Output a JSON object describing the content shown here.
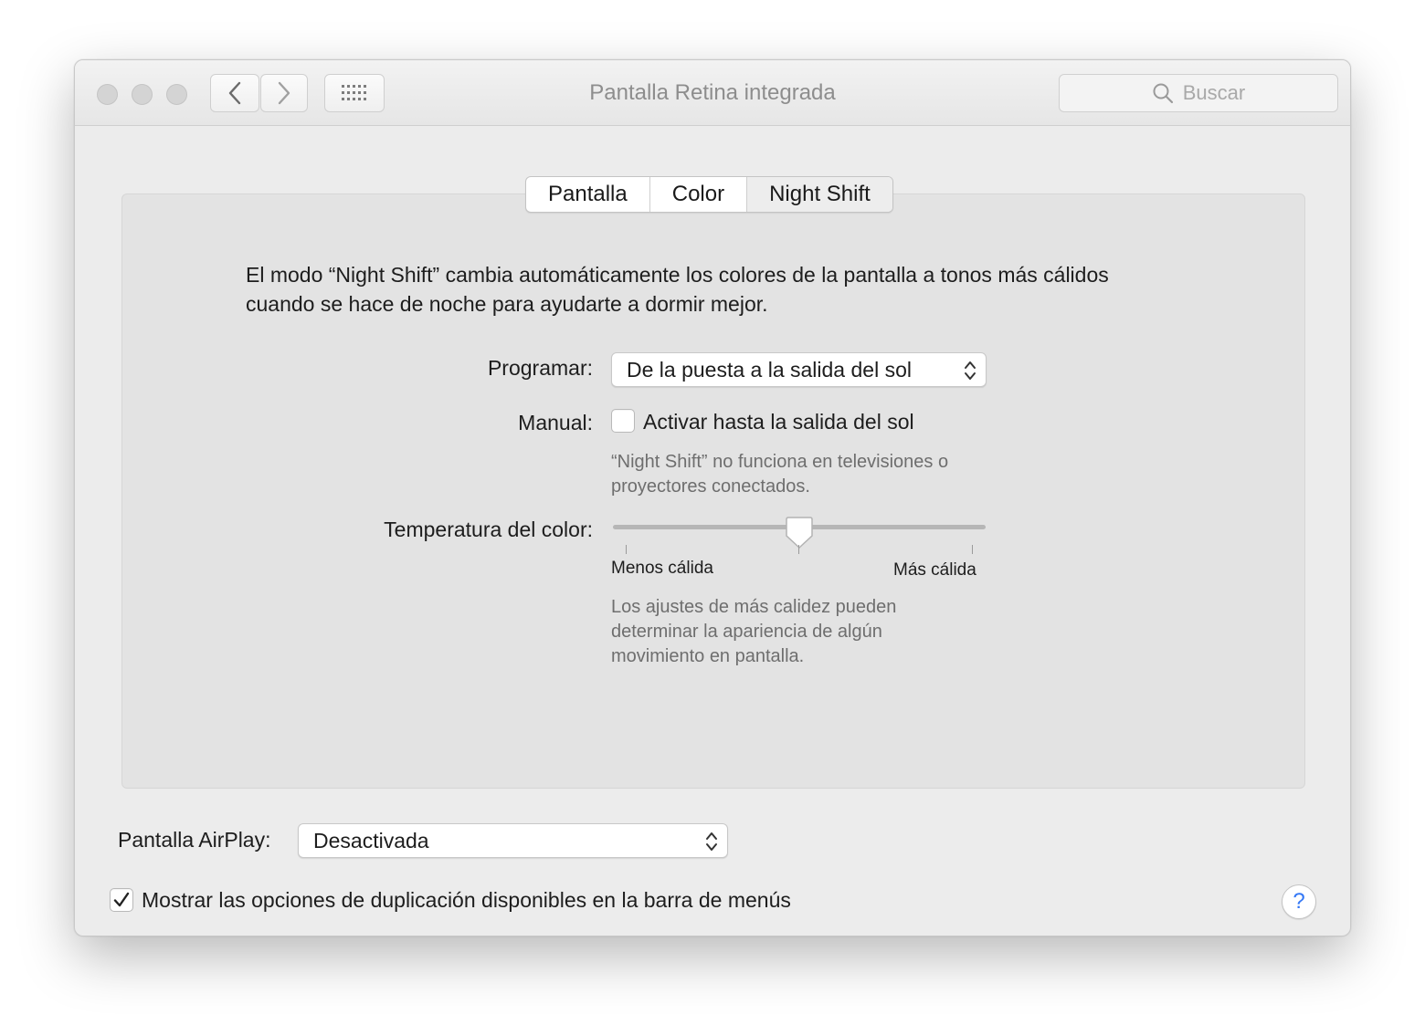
{
  "window": {
    "title": "Pantalla Retina integrada",
    "search_placeholder": "Buscar"
  },
  "tabs": [
    {
      "label": "Pantalla"
    },
    {
      "label": "Color"
    },
    {
      "label": "Night Shift",
      "selected": true
    }
  ],
  "night_shift": {
    "description": "El modo “Night Shift” cambia automáticamente los colores de la pantalla a tonos más cálidos cuando se hace de noche para ayudarte a dormir mejor.",
    "schedule_label": "Programar:",
    "schedule_value": "De la puesta a la salida del sol",
    "manual_label": "Manual:",
    "manual_checkbox_label": "Activar hasta la salida del sol",
    "manual_checked": false,
    "manual_note": "“Night Shift” no funciona en televisiones o proyectores conectados.",
    "temperature_label": "Temperatura del color:",
    "temperature_level": 0.5,
    "temperature_min_label": "Menos cálida",
    "temperature_max_label": "Más cálida",
    "temperature_note": "Los ajustes de más calidez pueden determinar la apariencia de algún movimiento en pantalla."
  },
  "airplay": {
    "label": "Pantalla AirPlay:",
    "value": "Desactivada"
  },
  "mirroring": {
    "label": "Mostrar las opciones de duplicación disponibles en la barra de menús",
    "checked": true
  },
  "help": {
    "label": "?"
  },
  "colors": {
    "accent": "#3478f6",
    "window_bg": "#ececec",
    "panel_bg": "#e3e3e3"
  }
}
